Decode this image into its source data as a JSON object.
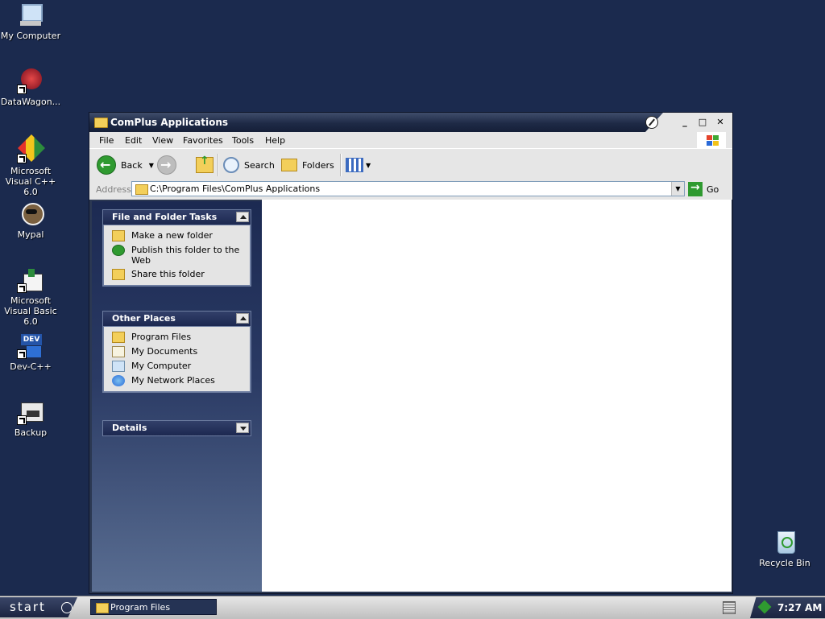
{
  "desktop": {
    "icons": [
      {
        "label": "My Computer"
      },
      {
        "label": "DataWagon..."
      },
      {
        "label": "Microsoft Visual C++ 6.0"
      },
      {
        "label": "Mypal"
      },
      {
        "label": "Microsoft Visual Basic 6.0"
      },
      {
        "label": "Dev-C++"
      },
      {
        "label": "Backup"
      },
      {
        "label": "Recycle Bin"
      }
    ]
  },
  "window": {
    "title": "ComPlus Applications",
    "menu": [
      "File",
      "Edit",
      "View",
      "Favorites",
      "Tools",
      "Help"
    ],
    "toolbar": {
      "back": "Back",
      "search": "Search",
      "folders": "Folders"
    },
    "address": {
      "label": "Address",
      "value": "C:\\Program Files\\ComPlus Applications",
      "go": "Go"
    },
    "taskpane": {
      "file_tasks": {
        "title": "File and Folder Tasks",
        "items": [
          "Make a new folder",
          "Publish this folder to the Web",
          "Share this folder"
        ]
      },
      "other_places": {
        "title": "Other Places",
        "items": [
          "Program Files",
          "My Documents",
          "My Computer",
          "My Network Places"
        ]
      },
      "details": {
        "title": "Details"
      }
    }
  },
  "taskbar": {
    "start": "start",
    "task": "Program Files",
    "clock": "7:27 AM"
  },
  "colors": {
    "desktop": "#1b2a4e",
    "title": "#1e2a46",
    "pane": "#2a3a64"
  }
}
